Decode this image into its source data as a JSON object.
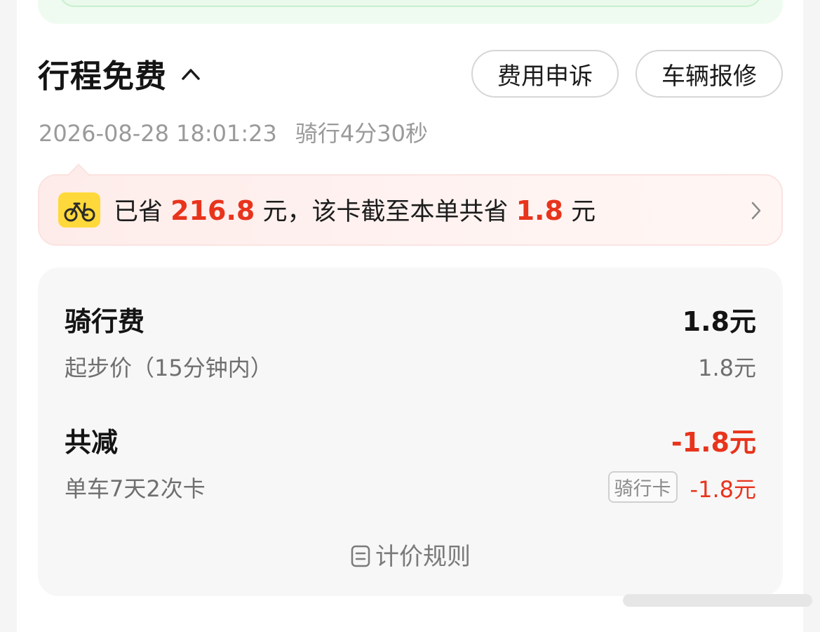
{
  "header": {
    "title": "行程免费",
    "appeal_label": "费用申诉",
    "repair_label": "车辆报修"
  },
  "trip": {
    "datetime": "2026-08-28 18:01:23",
    "duration": "骑行4分30秒"
  },
  "savings": {
    "prefix": "已省 ",
    "total_saved": "216.8",
    "middle": " 元，该卡截至本单共省 ",
    "order_saved": "1.8",
    "suffix": " 元",
    "icon": "bike-icon"
  },
  "fees": {
    "ride_fee_label": "骑行费",
    "ride_fee_value": "1.8元",
    "base_price_label": "起步价（15分钟内）",
    "base_price_value": "1.8元",
    "discount_label": "共减",
    "discount_value": "-1.8元",
    "card_label": "单车7天2次卡",
    "card_tag": "骑行卡",
    "card_value": "-1.8元",
    "rules_label": "计价规则"
  },
  "colors": {
    "accent_red": "#e8341c",
    "badge_yellow": "#ffd93b",
    "banner_green": "#effbf0"
  }
}
